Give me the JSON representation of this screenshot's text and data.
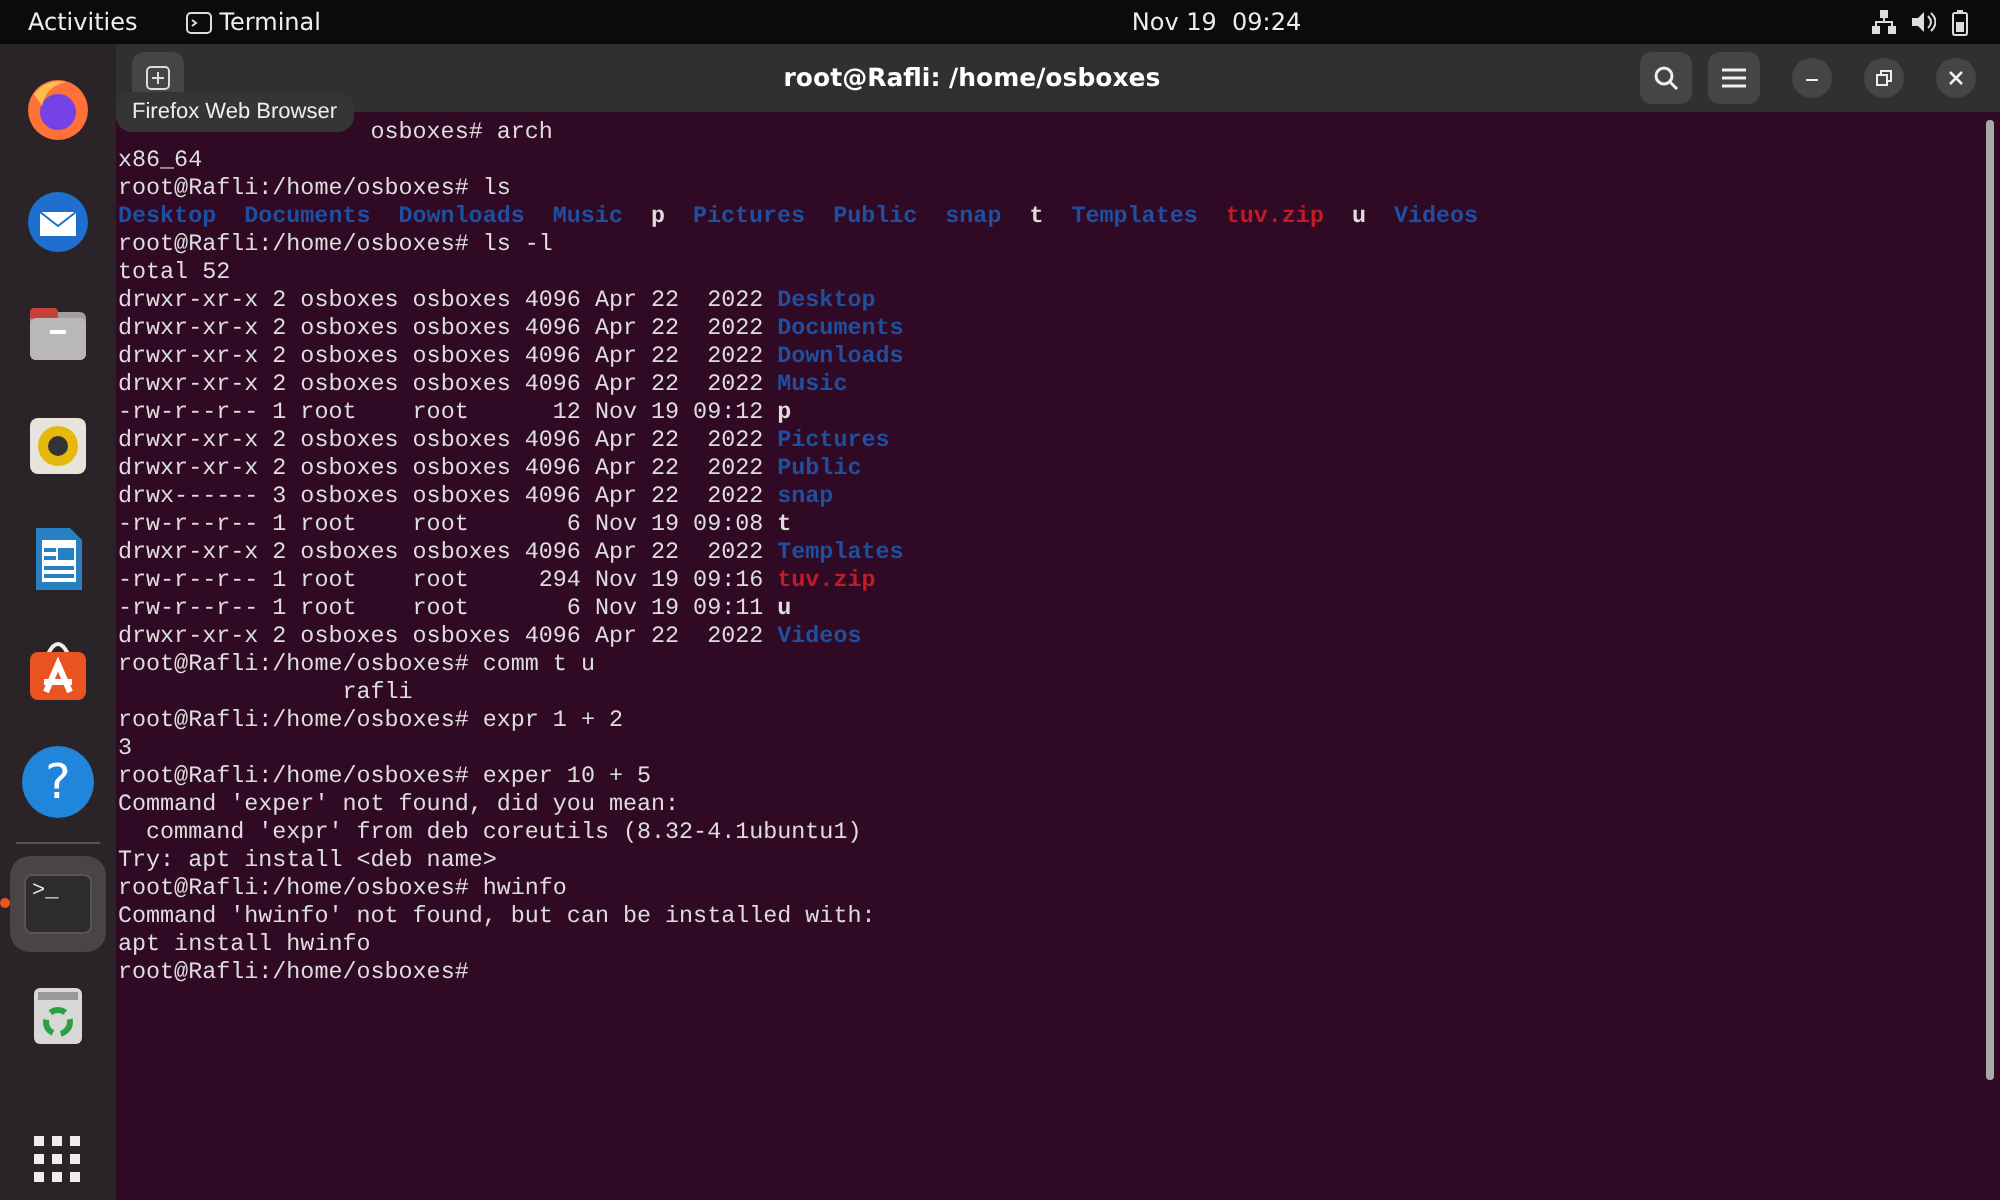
{
  "top_bar": {
    "activities": "Activities",
    "app_name": "Terminal",
    "clock": "Nov 19  09:24"
  },
  "dock": [
    {
      "kind": "firefox",
      "running": false
    },
    {
      "kind": "thunderbird",
      "running": false
    },
    {
      "kind": "files",
      "running": false
    },
    {
      "kind": "rhythmbox",
      "running": false
    },
    {
      "kind": "writer",
      "running": false
    },
    {
      "kind": "appcenter",
      "running": false
    },
    {
      "kind": "help",
      "glyph": "?",
      "running": false
    },
    {
      "kind": "terminal",
      "glyph": ">_",
      "running": true
    },
    {
      "kind": "trash",
      "running": false
    }
  ],
  "tooltip": "Firefox Web Browser",
  "window": {
    "title": "root@Rafli: /home/osboxes"
  },
  "terminal": [
    {
      "kind": "covered",
      "text": "osboxes# arch"
    },
    {
      "kind": "plain",
      "text": "x86_64"
    },
    {
      "kind": "plain",
      "text": "root@Rafli:/home/osboxes# ls"
    },
    {
      "kind": "listing",
      "items": [
        {
          "text": "Desktop",
          "color": "#1f4fa0"
        },
        {
          "text": "Documents",
          "color": "#1f4fa0"
        },
        {
          "text": "Downloads",
          "color": "#1f4fa0"
        },
        {
          "text": "Music",
          "color": "#1f4fa0"
        },
        {
          "text": "p",
          "color": "#dddddd"
        },
        {
          "text": "Pictures",
          "color": "#1f4fa0"
        },
        {
          "text": "Public",
          "color": "#1f4fa0"
        },
        {
          "text": "snap",
          "color": "#1f4fa0"
        },
        {
          "text": "t",
          "color": "#dddddd"
        },
        {
          "text": "Templates",
          "color": "#1f4fa0"
        },
        {
          "text": "tuv.zip",
          "color": "#c01c28"
        },
        {
          "text": "u",
          "color": "#dddddd"
        },
        {
          "text": "Videos",
          "color": "#1f4fa0"
        }
      ]
    },
    {
      "kind": "plain",
      "text": "root@Rafli:/home/osboxes# ls -l"
    },
    {
      "kind": "plain",
      "text": "total 52"
    },
    {
      "kind": "long",
      "meta": "drwxr-xr-x 2 osboxes osboxes 4096 Apr 22  2022",
      "name": "Desktop",
      "color": "#1f4fa0"
    },
    {
      "kind": "long",
      "meta": "drwxr-xr-x 2 osboxes osboxes 4096 Apr 22  2022",
      "name": "Documents",
      "color": "#1f4fa0"
    },
    {
      "kind": "long",
      "meta": "drwxr-xr-x 2 osboxes osboxes 4096 Apr 22  2022",
      "name": "Downloads",
      "color": "#1f4fa0"
    },
    {
      "kind": "long",
      "meta": "drwxr-xr-x 2 osboxes osboxes 4096 Apr 22  2022",
      "name": "Music",
      "color": "#1f4fa0"
    },
    {
      "kind": "long",
      "meta": "-rw-r--r-- 1 root    root      12 Nov 19 09:12",
      "name": "p",
      "color": "#dddddd"
    },
    {
      "kind": "long",
      "meta": "drwxr-xr-x 2 osboxes osboxes 4096 Apr 22  2022",
      "name": "Pictures",
      "color": "#1f4fa0"
    },
    {
      "kind": "long",
      "meta": "drwxr-xr-x 2 osboxes osboxes 4096 Apr 22  2022",
      "name": "Public",
      "color": "#1f4fa0"
    },
    {
      "kind": "long",
      "meta": "drwx------ 3 osboxes osboxes 4096 Apr 22  2022",
      "name": "snap",
      "color": "#1f4fa0"
    },
    {
      "kind": "long",
      "meta": "-rw-r--r-- 1 root    root       6 Nov 19 09:08",
      "name": "t",
      "color": "#dddddd"
    },
    {
      "kind": "long",
      "meta": "drwxr-xr-x 2 osboxes osboxes 4096 Apr 22  2022",
      "name": "Templates",
      "color": "#1f4fa0"
    },
    {
      "kind": "long",
      "meta": "-rw-r--r-- 1 root    root     294 Nov 19 09:16",
      "name": "tuv.zip",
      "color": "#c01c28"
    },
    {
      "kind": "long",
      "meta": "-rw-r--r-- 1 root    root       6 Nov 19 09:11",
      "name": "u",
      "color": "#dddddd"
    },
    {
      "kind": "long",
      "meta": "drwxr-xr-x 2 osboxes osboxes 4096 Apr 22  2022",
      "name": "Videos",
      "color": "#1f4fa0"
    },
    {
      "kind": "plain",
      "text": "root@Rafli:/home/osboxes# comm t u"
    },
    {
      "kind": "plain",
      "text": "                rafli"
    },
    {
      "kind": "plain",
      "text": "root@Rafli:/home/osboxes# expr 1 + 2"
    },
    {
      "kind": "plain",
      "text": "3"
    },
    {
      "kind": "plain",
      "text": "root@Rafli:/home/osboxes# exper 10 + 5"
    },
    {
      "kind": "plain",
      "text": "Command 'exper' not found, did you mean:"
    },
    {
      "kind": "plain",
      "text": "  command 'expr' from deb coreutils (8.32-4.1ubuntu1)"
    },
    {
      "kind": "plain",
      "text": "Try: apt install <deb name>"
    },
    {
      "kind": "plain",
      "text": "root@Rafli:/home/osboxes# hwinfo"
    },
    {
      "kind": "plain",
      "text": "Command 'hwinfo' not found, but can be installed with:"
    },
    {
      "kind": "plain",
      "text": "apt install hwinfo"
    },
    {
      "kind": "plain",
      "text": "root@Rafli:/home/osboxes#"
    }
  ]
}
